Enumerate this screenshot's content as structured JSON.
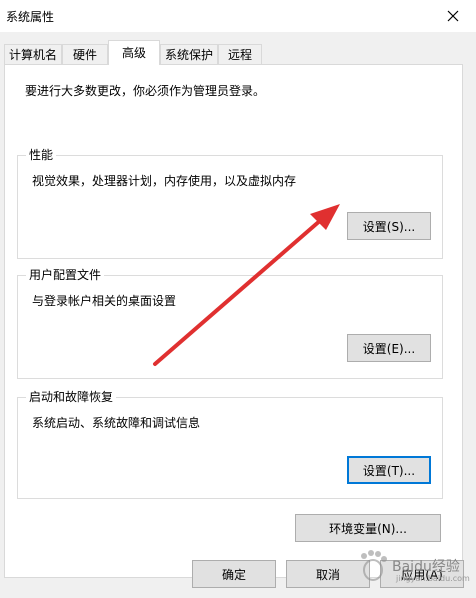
{
  "window": {
    "title": "系统属性",
    "close_icon": "close-icon"
  },
  "tabs": [
    {
      "label": "计算机名"
    },
    {
      "label": "硬件"
    },
    {
      "label": "高级",
      "active": true
    },
    {
      "label": "系统保护"
    },
    {
      "label": "远程"
    }
  ],
  "advanced": {
    "admin_note": "要进行大多数更改，你必须作为管理员登录。",
    "performance": {
      "title": "性能",
      "desc": "视觉效果，处理器计划，内存使用，以及虚拟内存",
      "button": "设置(S)..."
    },
    "user_profiles": {
      "title": "用户配置文件",
      "desc": "与登录帐户相关的桌面设置",
      "button": "设置(E)..."
    },
    "startup_recovery": {
      "title": "启动和故障恢复",
      "desc": "系统启动、系统故障和调试信息",
      "button": "设置(T)..."
    },
    "env_button": "环境变量(N)..."
  },
  "footer": {
    "ok": "确定",
    "cancel": "取消",
    "apply": "应用(A)"
  },
  "annotation": {
    "arrow_color": "#e03030"
  },
  "watermark": {
    "text": "Baidu经验",
    "sub": "jingyan.baidu.com"
  }
}
